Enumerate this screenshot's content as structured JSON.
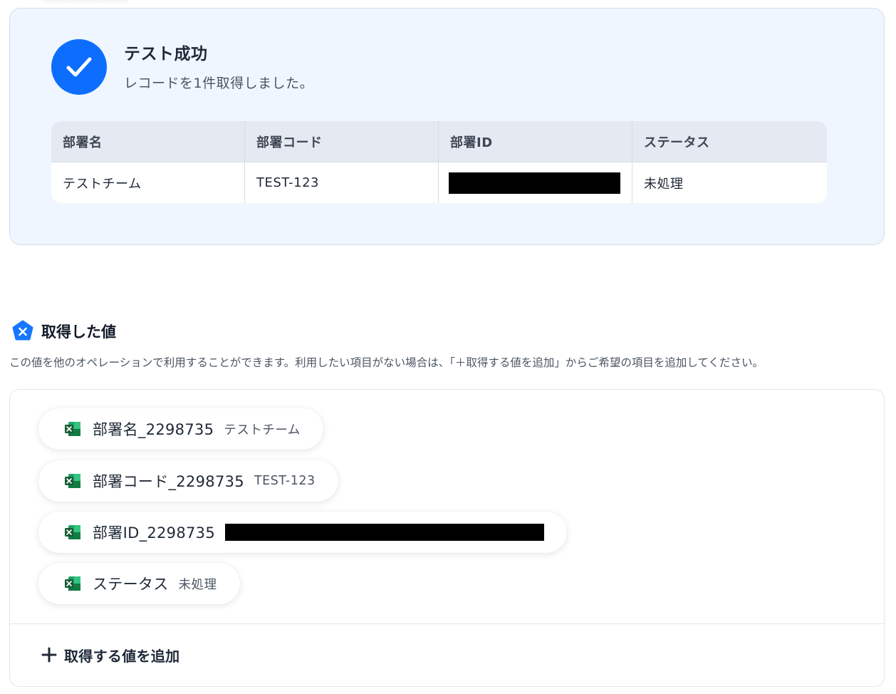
{
  "success": {
    "title": "テスト成功",
    "message": "レコードを1件取得しました。",
    "accent_color": "#0d6efd",
    "table": {
      "columns": [
        "部署名",
        "部署コード",
        "部署ID",
        "ステータス"
      ],
      "row": {
        "department_name": "テストチーム",
        "department_code": "TEST-123",
        "department_id": "",
        "status": "未処理"
      }
    }
  },
  "acquired": {
    "title": "取得した値",
    "description": "この値を他のオペレーションで利用することができます。利用したい項目がない場合は、「＋取得する値を追加」からご希望の項目を追加してください。",
    "items": [
      {
        "name": "部署名_2298735",
        "value": "テストチーム",
        "icon": "excel-icon"
      },
      {
        "name": "部署コード_2298735",
        "value": "TEST-123",
        "icon": "excel-icon"
      },
      {
        "name": "部署ID_2298735",
        "value": "",
        "icon": "excel-icon"
      },
      {
        "name": "ステータス",
        "value": "未処理",
        "icon": "excel-icon"
      }
    ],
    "add_button_label": "取得する値を追加"
  }
}
